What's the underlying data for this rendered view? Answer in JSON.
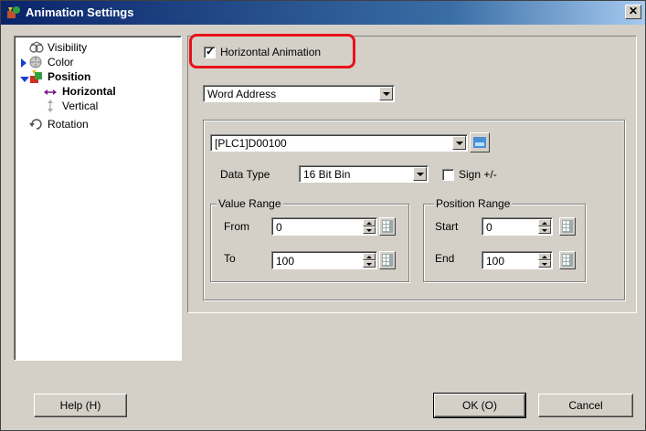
{
  "window": {
    "title": "Animation Settings",
    "close_label": "✕"
  },
  "tree": {
    "items": [
      {
        "label": "Visibility",
        "icon": "eye-icon"
      },
      {
        "label": "Color",
        "icon": "color-wheel-icon"
      },
      {
        "label": "Position",
        "icon": "position-icon"
      },
      {
        "label": "Horizontal",
        "icon": "horizontal-arrow-icon"
      },
      {
        "label": "Vertical",
        "icon": "vertical-arrow-icon"
      },
      {
        "label": "Rotation",
        "icon": "rotation-icon"
      }
    ]
  },
  "main": {
    "horizontal_animation": {
      "label": "Horizontal Animation",
      "checked": true
    },
    "address_type": {
      "value": "Word Address"
    },
    "address": {
      "value": "[PLC1]D00100"
    },
    "data_type": {
      "label": "Data Type",
      "value": "16 Bit Bin"
    },
    "sign": {
      "label": "Sign +/-",
      "checked": false
    },
    "value_range": {
      "label": "Value Range",
      "from_label": "From",
      "from_value": "0",
      "to_label": "To",
      "to_value": "100"
    },
    "position_range": {
      "label": "Position Range",
      "start_label": "Start",
      "start_value": "0",
      "end_label": "End",
      "end_value": "100"
    }
  },
  "buttons": {
    "help": "Help (H)",
    "ok": "OK (O)",
    "cancel": "Cancel"
  },
  "colors": {
    "title_bar": "#0a246a",
    "highlight": "#e8111b",
    "face": "#d4d0c8"
  }
}
